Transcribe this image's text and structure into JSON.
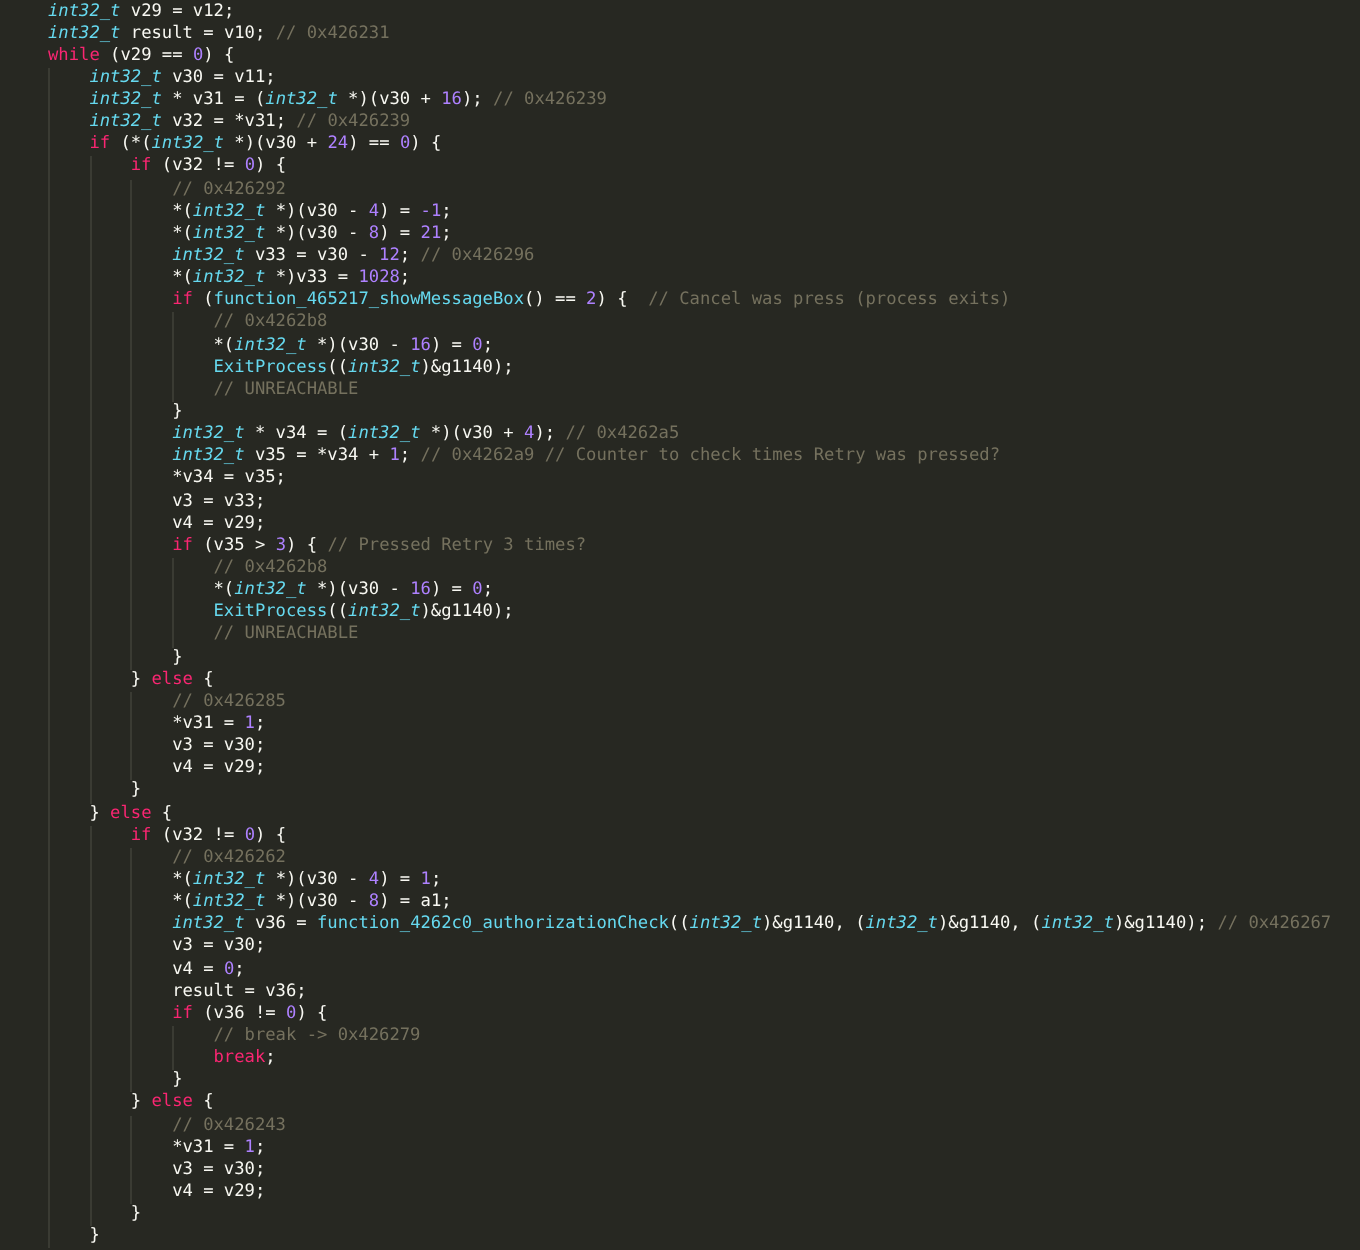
{
  "code_lines": [
    {
      "tokens": [
        {
          "kind": "type",
          "text": "int32_t"
        },
        {
          "kind": "plain",
          "text": " v29 = v12;"
        }
      ]
    },
    {
      "tokens": [
        {
          "kind": "type",
          "text": "int32_t"
        },
        {
          "kind": "plain",
          "text": " result = v10; "
        },
        {
          "kind": "comment",
          "text": "// 0x426231"
        }
      ]
    },
    {
      "tokens": [
        {
          "kind": "keyword",
          "text": "while"
        },
        {
          "kind": "plain",
          "text": " (v29 == "
        },
        {
          "kind": "number",
          "text": "0"
        },
        {
          "kind": "plain",
          "text": ") {"
        }
      ],
      "children": [
        {
          "tokens": [
            {
              "kind": "type",
              "text": "int32_t"
            },
            {
              "kind": "plain",
              "text": " v30 = v11;"
            }
          ]
        },
        {
          "tokens": [
            {
              "kind": "type",
              "text": "int32_t"
            },
            {
              "kind": "plain",
              "text": " * v31 = ("
            },
            {
              "kind": "type",
              "text": "int32_t"
            },
            {
              "kind": "plain",
              "text": " *)(v30 + "
            },
            {
              "kind": "number",
              "text": "16"
            },
            {
              "kind": "plain",
              "text": "); "
            },
            {
              "kind": "comment",
              "text": "// 0x426239"
            }
          ]
        },
        {
          "tokens": [
            {
              "kind": "type",
              "text": "int32_t"
            },
            {
              "kind": "plain",
              "text": " v32 = *v31; "
            },
            {
              "kind": "comment",
              "text": "// 0x426239"
            }
          ]
        },
        {
          "tokens": [
            {
              "kind": "keyword",
              "text": "if"
            },
            {
              "kind": "plain",
              "text": " (*("
            },
            {
              "kind": "type",
              "text": "int32_t"
            },
            {
              "kind": "plain",
              "text": " *)(v30 + "
            },
            {
              "kind": "number",
              "text": "24"
            },
            {
              "kind": "plain",
              "text": ") == "
            },
            {
              "kind": "number",
              "text": "0"
            },
            {
              "kind": "plain",
              "text": ") {"
            }
          ],
          "children": [
            {
              "tokens": [
                {
                  "kind": "keyword",
                  "text": "if"
                },
                {
                  "kind": "plain",
                  "text": " (v32 != "
                },
                {
                  "kind": "number",
                  "text": "0"
                },
                {
                  "kind": "plain",
                  "text": ") {"
                }
              ],
              "children": [
                {
                  "tokens": [
                    {
                      "kind": "comment",
                      "text": "// 0x426292"
                    }
                  ]
                },
                {
                  "tokens": [
                    {
                      "kind": "plain",
                      "text": "*("
                    },
                    {
                      "kind": "type",
                      "text": "int32_t"
                    },
                    {
                      "kind": "plain",
                      "text": " *)(v30 - "
                    },
                    {
                      "kind": "number",
                      "text": "4"
                    },
                    {
                      "kind": "plain",
                      "text": ") = "
                    },
                    {
                      "kind": "number",
                      "text": "-1"
                    },
                    {
                      "kind": "plain",
                      "text": ";"
                    }
                  ]
                },
                {
                  "tokens": [
                    {
                      "kind": "plain",
                      "text": "*("
                    },
                    {
                      "kind": "type",
                      "text": "int32_t"
                    },
                    {
                      "kind": "plain",
                      "text": " *)(v30 - "
                    },
                    {
                      "kind": "number",
                      "text": "8"
                    },
                    {
                      "kind": "plain",
                      "text": ") = "
                    },
                    {
                      "kind": "number",
                      "text": "21"
                    },
                    {
                      "kind": "plain",
                      "text": ";"
                    }
                  ]
                },
                {
                  "tokens": [
                    {
                      "kind": "type",
                      "text": "int32_t"
                    },
                    {
                      "kind": "plain",
                      "text": " v33 = v30 - "
                    },
                    {
                      "kind": "number",
                      "text": "12"
                    },
                    {
                      "kind": "plain",
                      "text": "; "
                    },
                    {
                      "kind": "comment",
                      "text": "// 0x426296"
                    }
                  ]
                },
                {
                  "tokens": [
                    {
                      "kind": "plain",
                      "text": "*("
                    },
                    {
                      "kind": "type",
                      "text": "int32_t"
                    },
                    {
                      "kind": "plain",
                      "text": " *)v33 = "
                    },
                    {
                      "kind": "number",
                      "text": "1028"
                    },
                    {
                      "kind": "plain",
                      "text": ";"
                    }
                  ]
                },
                {
                  "tokens": [
                    {
                      "kind": "keyword",
                      "text": "if"
                    },
                    {
                      "kind": "plain",
                      "text": " ("
                    },
                    {
                      "kind": "function",
                      "text": "function_465217_showMessageBox"
                    },
                    {
                      "kind": "plain",
                      "text": "() == "
                    },
                    {
                      "kind": "number",
                      "text": "2"
                    },
                    {
                      "kind": "plain",
                      "text": ") {  "
                    },
                    {
                      "kind": "comment",
                      "text": "// Cancel was press (process exits)"
                    }
                  ],
                  "children": [
                    {
                      "tokens": [
                        {
                          "kind": "comment",
                          "text": "// 0x4262b8"
                        }
                      ]
                    },
                    {
                      "tokens": [
                        {
                          "kind": "plain",
                          "text": "*("
                        },
                        {
                          "kind": "type",
                          "text": "int32_t"
                        },
                        {
                          "kind": "plain",
                          "text": " *)(v30 - "
                        },
                        {
                          "kind": "number",
                          "text": "16"
                        },
                        {
                          "kind": "plain",
                          "text": ") = "
                        },
                        {
                          "kind": "number",
                          "text": "0"
                        },
                        {
                          "kind": "plain",
                          "text": ";"
                        }
                      ]
                    },
                    {
                      "tokens": [
                        {
                          "kind": "function",
                          "text": "ExitProcess"
                        },
                        {
                          "kind": "plain",
                          "text": "(("
                        },
                        {
                          "kind": "type",
                          "text": "int32_t"
                        },
                        {
                          "kind": "plain",
                          "text": ")&g1140);"
                        }
                      ]
                    },
                    {
                      "tokens": [
                        {
                          "kind": "comment",
                          "text": "// UNREACHABLE"
                        }
                      ]
                    }
                  ]
                },
                {
                  "tokens": [
                    {
                      "kind": "plain",
                      "text": "}"
                    }
                  ]
                },
                {
                  "tokens": [
                    {
                      "kind": "type",
                      "text": "int32_t"
                    },
                    {
                      "kind": "plain",
                      "text": " * v34 = ("
                    },
                    {
                      "kind": "type",
                      "text": "int32_t"
                    },
                    {
                      "kind": "plain",
                      "text": " *)(v30 + "
                    },
                    {
                      "kind": "number",
                      "text": "4"
                    },
                    {
                      "kind": "plain",
                      "text": "); "
                    },
                    {
                      "kind": "comment",
                      "text": "// 0x4262a5"
                    }
                  ]
                },
                {
                  "tokens": [
                    {
                      "kind": "type",
                      "text": "int32_t"
                    },
                    {
                      "kind": "plain",
                      "text": " v35 = *v34 + "
                    },
                    {
                      "kind": "number",
                      "text": "1"
                    },
                    {
                      "kind": "plain",
                      "text": "; "
                    },
                    {
                      "kind": "comment",
                      "text": "// 0x4262a9 // Counter to check times Retry was pressed?"
                    }
                  ]
                },
                {
                  "tokens": [
                    {
                      "kind": "plain",
                      "text": "*v34 = v35;"
                    }
                  ]
                },
                {
                  "tokens": [
                    {
                      "kind": "plain",
                      "text": "v3 = v33;"
                    }
                  ]
                },
                {
                  "tokens": [
                    {
                      "kind": "plain",
                      "text": "v4 = v29;"
                    }
                  ]
                },
                {
                  "tokens": [
                    {
                      "kind": "keyword",
                      "text": "if"
                    },
                    {
                      "kind": "plain",
                      "text": " (v35 > "
                    },
                    {
                      "kind": "number",
                      "text": "3"
                    },
                    {
                      "kind": "plain",
                      "text": ") { "
                    },
                    {
                      "kind": "comment",
                      "text": "// Pressed Retry 3 times?"
                    }
                  ],
                  "children": [
                    {
                      "tokens": [
                        {
                          "kind": "comment",
                          "text": "// 0x4262b8"
                        }
                      ]
                    },
                    {
                      "tokens": [
                        {
                          "kind": "plain",
                          "text": "*("
                        },
                        {
                          "kind": "type",
                          "text": "int32_t"
                        },
                        {
                          "kind": "plain",
                          "text": " *)(v30 - "
                        },
                        {
                          "kind": "number",
                          "text": "16"
                        },
                        {
                          "kind": "plain",
                          "text": ") = "
                        },
                        {
                          "kind": "number",
                          "text": "0"
                        },
                        {
                          "kind": "plain",
                          "text": ";"
                        }
                      ]
                    },
                    {
                      "tokens": [
                        {
                          "kind": "function",
                          "text": "ExitProcess"
                        },
                        {
                          "kind": "plain",
                          "text": "(("
                        },
                        {
                          "kind": "type",
                          "text": "int32_t"
                        },
                        {
                          "kind": "plain",
                          "text": ")&g1140);"
                        }
                      ]
                    },
                    {
                      "tokens": [
                        {
                          "kind": "comment",
                          "text": "// UNREACHABLE"
                        }
                      ]
                    }
                  ]
                },
                {
                  "tokens": [
                    {
                      "kind": "plain",
                      "text": "}"
                    }
                  ]
                }
              ]
            },
            {
              "tokens": [
                {
                  "kind": "plain",
                  "text": "} "
                },
                {
                  "kind": "keyword",
                  "text": "else"
                },
                {
                  "kind": "plain",
                  "text": " {"
                }
              ],
              "children": [
                {
                  "tokens": [
                    {
                      "kind": "comment",
                      "text": "// 0x426285"
                    }
                  ]
                },
                {
                  "tokens": [
                    {
                      "kind": "plain",
                      "text": "*v31 = "
                    },
                    {
                      "kind": "number",
                      "text": "1"
                    },
                    {
                      "kind": "plain",
                      "text": ";"
                    }
                  ]
                },
                {
                  "tokens": [
                    {
                      "kind": "plain",
                      "text": "v3 = v30;"
                    }
                  ]
                },
                {
                  "tokens": [
                    {
                      "kind": "plain",
                      "text": "v4 = v29;"
                    }
                  ]
                }
              ]
            },
            {
              "tokens": [
                {
                  "kind": "plain",
                  "text": "}"
                }
              ]
            }
          ]
        },
        {
          "tokens": [
            {
              "kind": "plain",
              "text": "} "
            },
            {
              "kind": "keyword",
              "text": "else"
            },
            {
              "kind": "plain",
              "text": " {"
            }
          ],
          "children": [
            {
              "tokens": [
                {
                  "kind": "keyword",
                  "text": "if"
                },
                {
                  "kind": "plain",
                  "text": " (v32 != "
                },
                {
                  "kind": "number",
                  "text": "0"
                },
                {
                  "kind": "plain",
                  "text": ") {"
                }
              ],
              "children": [
                {
                  "tokens": [
                    {
                      "kind": "comment",
                      "text": "// 0x426262"
                    }
                  ]
                },
                {
                  "tokens": [
                    {
                      "kind": "plain",
                      "text": "*("
                    },
                    {
                      "kind": "type",
                      "text": "int32_t"
                    },
                    {
                      "kind": "plain",
                      "text": " *)(v30 - "
                    },
                    {
                      "kind": "number",
                      "text": "4"
                    },
                    {
                      "kind": "plain",
                      "text": ") = "
                    },
                    {
                      "kind": "number",
                      "text": "1"
                    },
                    {
                      "kind": "plain",
                      "text": ";"
                    }
                  ]
                },
                {
                  "tokens": [
                    {
                      "kind": "plain",
                      "text": "*("
                    },
                    {
                      "kind": "type",
                      "text": "int32_t"
                    },
                    {
                      "kind": "plain",
                      "text": " *)(v30 - "
                    },
                    {
                      "kind": "number",
                      "text": "8"
                    },
                    {
                      "kind": "plain",
                      "text": ") = a1;"
                    }
                  ]
                },
                {
                  "tokens": [
                    {
                      "kind": "type",
                      "text": "int32_t"
                    },
                    {
                      "kind": "plain",
                      "text": " v36 = "
                    },
                    {
                      "kind": "function",
                      "text": "function_4262c0_authorizationCheck"
                    },
                    {
                      "kind": "plain",
                      "text": "(("
                    },
                    {
                      "kind": "type",
                      "text": "int32_t"
                    },
                    {
                      "kind": "plain",
                      "text": ")&g1140, ("
                    },
                    {
                      "kind": "type",
                      "text": "int32_t"
                    },
                    {
                      "kind": "plain",
                      "text": ")&g1140, ("
                    },
                    {
                      "kind": "type",
                      "text": "int32_t"
                    },
                    {
                      "kind": "plain",
                      "text": ")&g1140); "
                    },
                    {
                      "kind": "comment",
                      "text": "// 0x426267"
                    }
                  ]
                },
                {
                  "tokens": [
                    {
                      "kind": "plain",
                      "text": "v3 = v30;"
                    }
                  ]
                },
                {
                  "tokens": [
                    {
                      "kind": "plain",
                      "text": "v4 = "
                    },
                    {
                      "kind": "number",
                      "text": "0"
                    },
                    {
                      "kind": "plain",
                      "text": ";"
                    }
                  ]
                },
                {
                  "tokens": [
                    {
                      "kind": "plain",
                      "text": "result = v36;"
                    }
                  ]
                },
                {
                  "tokens": [
                    {
                      "kind": "keyword",
                      "text": "if"
                    },
                    {
                      "kind": "plain",
                      "text": " (v36 != "
                    },
                    {
                      "kind": "number",
                      "text": "0"
                    },
                    {
                      "kind": "plain",
                      "text": ") {"
                    }
                  ],
                  "children": [
                    {
                      "tokens": [
                        {
                          "kind": "comment",
                          "text": "// break -> 0x426279"
                        }
                      ]
                    },
                    {
                      "tokens": [
                        {
                          "kind": "keyword",
                          "text": "break"
                        },
                        {
                          "kind": "plain",
                          "text": ";"
                        }
                      ]
                    }
                  ]
                },
                {
                  "tokens": [
                    {
                      "kind": "plain",
                      "text": "}"
                    }
                  ]
                }
              ]
            },
            {
              "tokens": [
                {
                  "kind": "plain",
                  "text": "} "
                },
                {
                  "kind": "keyword",
                  "text": "else"
                },
                {
                  "kind": "plain",
                  "text": " {"
                }
              ],
              "children": [
                {
                  "tokens": [
                    {
                      "kind": "comment",
                      "text": "// 0x426243"
                    }
                  ]
                },
                {
                  "tokens": [
                    {
                      "kind": "plain",
                      "text": "*v31 = "
                    },
                    {
                      "kind": "number",
                      "text": "1"
                    },
                    {
                      "kind": "plain",
                      "text": ";"
                    }
                  ]
                },
                {
                  "tokens": [
                    {
                      "kind": "plain",
                      "text": "v3 = v30;"
                    }
                  ]
                },
                {
                  "tokens": [
                    {
                      "kind": "plain",
                      "text": "v4 = v29;"
                    }
                  ]
                }
              ]
            },
            {
              "tokens": [
                {
                  "kind": "plain",
                  "text": "}"
                }
              ]
            }
          ]
        },
        {
          "tokens": [
            {
              "kind": "plain",
              "text": "}"
            }
          ]
        }
      ]
    }
  ]
}
